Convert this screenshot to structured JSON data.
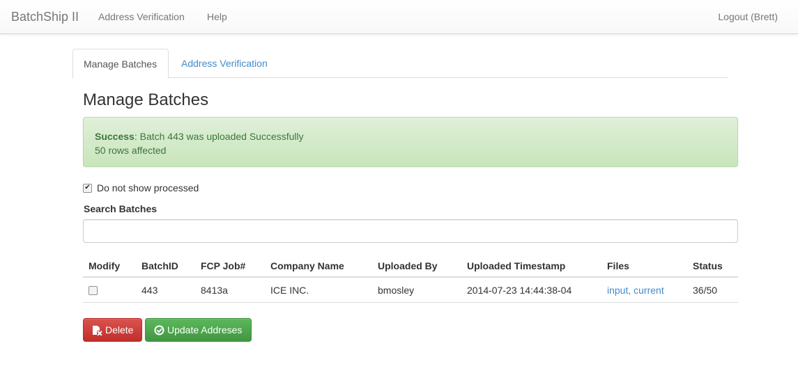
{
  "navbar": {
    "brand": "BatchShip II",
    "links": [
      "Address Verification",
      "Help"
    ],
    "logout": "Logout (Brett)"
  },
  "tabs": [
    {
      "label": "Manage Batches",
      "active": true
    },
    {
      "label": "Address Verification",
      "active": false
    }
  ],
  "page_title": "Manage Batches",
  "alert": {
    "strong": "Success",
    "message": ": Batch 443 was uploaded Successfully",
    "detail": "50 rows affected"
  },
  "filter": {
    "checkbox_label": "Do not show processed",
    "checked": true
  },
  "search": {
    "label": "Search Batches",
    "value": "",
    "placeholder": ""
  },
  "table": {
    "headers": [
      "Modify",
      "BatchID",
      "FCP Job#",
      "Company Name",
      "Uploaded By",
      "Uploaded Timestamp",
      "Files",
      "Status"
    ],
    "rows": [
      {
        "checked": false,
        "batch_id": "443",
        "fcp_job": "8413a",
        "company": "ICE INC.",
        "uploaded_by": "bmosley",
        "timestamp": "2014-07-23 14:44:38-04",
        "files_input": "input",
        "files_sep": ",",
        "files_current": "current",
        "status": "36/50"
      }
    ]
  },
  "buttons": {
    "delete": "Delete",
    "update": "Update Addreses"
  },
  "colors": {
    "link": "#428bca",
    "success_bg": "#dff0d8",
    "success_text": "#3c763d",
    "danger": "#d9534f",
    "success_btn": "#5cb85c"
  },
  "icons": {
    "delete_icon": "file-remove-icon",
    "update_icon": "check-circle-icon",
    "checkbox_check": "✔"
  }
}
